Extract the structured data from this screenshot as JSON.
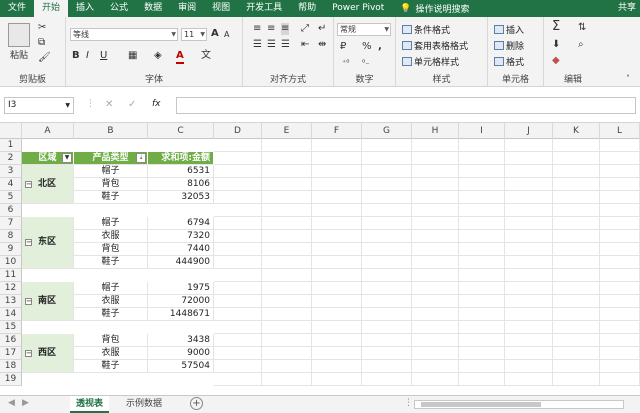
{
  "ribbon_tabs": [
    "文件",
    "开始",
    "插入",
    "公式",
    "数据",
    "审阅",
    "视图",
    "开发工具",
    "帮助",
    "Power Pivot"
  ],
  "active_tab_index": 1,
  "tell_me": "操作说明搜索",
  "share": "共享",
  "groups": {
    "clipboard": {
      "label": "剪贴板",
      "paste": "粘贴"
    },
    "font": {
      "label": "字体",
      "font_name": "等线",
      "font_size": "11",
      "bold": "B",
      "italic": "I",
      "underline": "U",
      "grow": "A",
      "shrink": "A"
    },
    "alignment": {
      "label": "对齐方式"
    },
    "number": {
      "label": "数字",
      "format": "常规",
      "percent": "%",
      "comma": ","
    },
    "styles": {
      "label": "样式",
      "conditional": "条件格式",
      "table": "套用表格格式",
      "cell": "单元格样式"
    },
    "cells": {
      "label": "单元格",
      "insert": "插入",
      "delete": "删除",
      "format": "格式"
    },
    "editing": {
      "label": "编辑",
      "sum": "Σ"
    }
  },
  "formula_bar": {
    "name_box": "I3",
    "cancel": "✕",
    "enter": "✓",
    "fx": "fx",
    "value": ""
  },
  "columns": [
    "A",
    "B",
    "C",
    "D",
    "E",
    "F",
    "G",
    "H",
    "I",
    "J",
    "K",
    "L"
  ],
  "rows": [
    "1",
    "2",
    "3",
    "4",
    "5",
    "6",
    "7",
    "8",
    "9",
    "10",
    "11",
    "12",
    "13",
    "14",
    "15",
    "16",
    "17",
    "18",
    "19"
  ],
  "pivot": {
    "header_region": "区域",
    "header_product": "产品类型",
    "header_sum": "求和项:金额",
    "groups": [
      {
        "region": "北区",
        "items": [
          [
            "帽子",
            "6531"
          ],
          [
            "背包",
            "8106"
          ],
          [
            "鞋子",
            "32053"
          ]
        ]
      },
      {
        "region": "东区",
        "items": [
          [
            "帽子",
            "6794"
          ],
          [
            "衣服",
            "7320"
          ],
          [
            "背包",
            "7440"
          ],
          [
            "鞋子",
            "444900"
          ]
        ]
      },
      {
        "region": "南区",
        "items": [
          [
            "帽子",
            "1975"
          ],
          [
            "衣服",
            "72000"
          ],
          [
            "鞋子",
            "1448671"
          ]
        ]
      },
      {
        "region": "西区",
        "items": [
          [
            "背包",
            "3438"
          ],
          [
            "衣服",
            "9000"
          ],
          [
            "鞋子",
            "57504"
          ]
        ]
      }
    ]
  },
  "sheet_tabs": [
    "透视表",
    "示例数据"
  ],
  "active_sheet_index": 0,
  "accent_color": "#217346",
  "pivot_header_color": "#70ad47",
  "pivot_region_color": "#e2efda"
}
